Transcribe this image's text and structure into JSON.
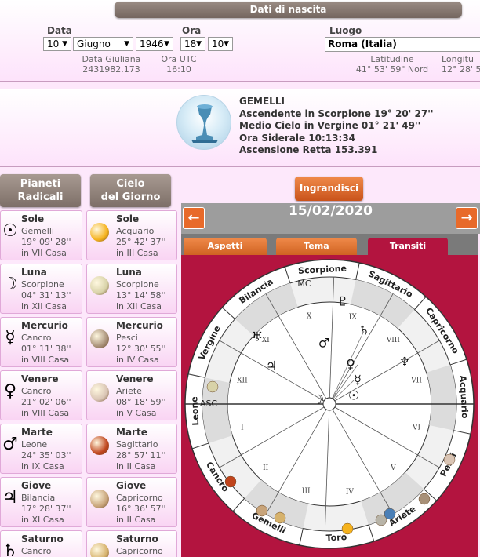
{
  "birth": {
    "title": "Dati di nascita",
    "data_label": "Data",
    "ora_label": "Ora",
    "luogo_label": "Luogo",
    "day": "10",
    "month": "Giugno",
    "year": "1946",
    "hour": "18",
    "minute": "10",
    "place": "Roma (Italia)",
    "julian_label": "Data Giuliana",
    "julian_value": "2431982.173",
    "utc_label": "Ora UTC",
    "utc_value": "16:10",
    "lat_label": "Latitudine",
    "lat_value": "41° 53' 59\" Nord",
    "lon_label": "Longitu",
    "lon_value": "12° 28' 5"
  },
  "sign": {
    "name": "GEMELLI",
    "asc": "Ascendente in Scorpione 19° 20' 27''",
    "mc": "Medio Cielo in Vergine 01° 21' 49''",
    "sidereal": "Ora Siderale 10:13:34",
    "ra": "Ascensione Retta 153.391"
  },
  "columns": {
    "radicali": [
      "Pianeti",
      "Radicali"
    ],
    "cielo": [
      "Cielo",
      "del Giorno"
    ]
  },
  "radicali": [
    {
      "name": "Sole",
      "glyph": "☉",
      "sign": "Gemelli",
      "deg": "19° 09' 28''",
      "house": "in VII Casa"
    },
    {
      "name": "Luna",
      "glyph": "☽",
      "sign": "Scorpione",
      "deg": "04° 31' 13''",
      "house": "in XII Casa"
    },
    {
      "name": "Mercurio",
      "glyph": "☿",
      "sign": "Cancro",
      "deg": "01° 11' 38''",
      "house": "in VIII Casa"
    },
    {
      "name": "Venere",
      "glyph": "♀",
      "sign": "Cancro",
      "deg": "21° 02' 06''",
      "house": "in VIII Casa"
    },
    {
      "name": "Marte",
      "glyph": "♂",
      "sign": "Leone",
      "deg": "24° 35' 03''",
      "house": "in IX Casa"
    },
    {
      "name": "Giove",
      "glyph": "♃",
      "sign": "Bilancia",
      "deg": "17° 28' 37''",
      "house": "in XI Casa"
    },
    {
      "name": "Saturno",
      "glyph": "♄",
      "sign": "Cancro",
      "deg": "",
      "house": ""
    }
  ],
  "cielo": [
    {
      "name": "Sole",
      "sign": "Acquario",
      "deg": "25° 42' 37''",
      "house": "in III Casa",
      "color": "#f5b21c"
    },
    {
      "name": "Luna",
      "sign": "Scorpione",
      "deg": "13° 14' 58''",
      "house": "in XII Casa",
      "color": "#d8d2a8"
    },
    {
      "name": "Mercurio",
      "sign": "Pesci",
      "deg": "12° 30' 55''",
      "house": "in IV Casa",
      "color": "#a89078"
    },
    {
      "name": "Venere",
      "sign": "Ariete",
      "deg": "08° 18' 59''",
      "house": "in V Casa",
      "color": "#d9c4b4"
    },
    {
      "name": "Marte",
      "sign": "Sagittario",
      "deg": "28° 57' 11''",
      "house": "in II Casa",
      "color": "#c0441c"
    },
    {
      "name": "Giove",
      "sign": "Capricorno",
      "deg": "16° 36' 57''",
      "house": "in II Casa",
      "color": "#c8a47a"
    },
    {
      "name": "Saturno",
      "sign": "Capricorno",
      "deg": "",
      "house": "",
      "color": "#d6b26c"
    }
  ],
  "chart": {
    "enlarge": "Ingrandisci",
    "date": "15/02/2020",
    "tabs": [
      "Aspetti",
      "Tema",
      "Transiti"
    ],
    "active_tab": "Transiti",
    "signs": [
      "Leone",
      "Cancro",
      "Gemelli",
      "Toro",
      "Ariete",
      "Pesci",
      "Acquario",
      "Capricorno",
      "Sagittario",
      "Scorpione",
      "Bilancia",
      "Vergine"
    ],
    "houses": [
      "I",
      "II",
      "III",
      "IV",
      "V",
      "VI",
      "VII",
      "VIII",
      "IX",
      "X",
      "XI",
      "XII"
    ],
    "mc": "MC",
    "asc": "ASC",
    "natal_glyphs": [
      "☽",
      "☉",
      "☿",
      "♀",
      "♂",
      "♃",
      "♄",
      "♅",
      "♆",
      "♇"
    ]
  }
}
